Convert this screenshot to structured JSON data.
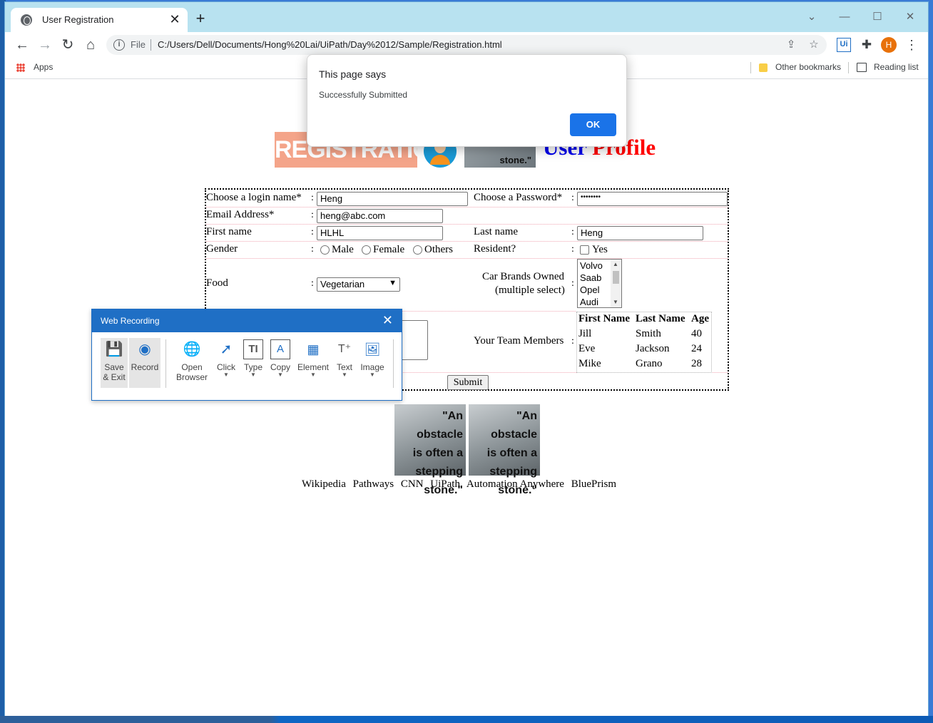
{
  "browser": {
    "tab_title": "User Registration",
    "tab_close": "✕",
    "new_tab": "+",
    "scheme": "File",
    "url": "C:/Users/Dell/Documents/Hong%20Lai/UiPath/Day%2012/Sample/Registration.html",
    "ext_uipath": "Ui",
    "avatar_letter": "H",
    "bookmarks": {
      "apps": "Apps",
      "other": "Other bookmarks",
      "reading": "Reading list"
    }
  },
  "alert": {
    "heading": "This page says",
    "message": "Successfully Submitted",
    "ok_label": "OK"
  },
  "page": {
    "banner_text": "REGISTRATION",
    "stone_caption": "stone.\"",
    "title_word1": "User",
    "title_word2": "Profile",
    "form": {
      "login_label": "Choose a login name*",
      "login_value": "Heng",
      "password_label": "Choose a Password*",
      "password_value": "••••••••",
      "email_label": "Email Address*",
      "email_value": "heng@abc.com",
      "first_label": "First name",
      "first_value": "HLHL",
      "last_label": "Last name",
      "last_value": "Heng",
      "gender_label": "Gender",
      "gender_options": [
        "Male",
        "Female",
        "Others"
      ],
      "resident_label": "Resident?",
      "resident_option": "Yes",
      "food_label": "Food",
      "food_value": "Vegetarian",
      "cars_label_1": "Car Brands Owned",
      "cars_label_2": "(multiple select)",
      "cars": [
        "Volvo",
        "Saab",
        "Opel",
        "Audi"
      ],
      "team_label": "Your Team Members",
      "team_headers": [
        "First Name",
        "Last Name",
        "Age"
      ],
      "team_rows": [
        [
          "Jill",
          "Smith",
          "40"
        ],
        [
          "Eve",
          "Jackson",
          "24"
        ],
        [
          "Mike",
          "Grano",
          "28"
        ]
      ],
      "submit_label": "Submit"
    },
    "quote": [
      "\"An obstacle",
      "is often a",
      "stepping",
      "stone.\""
    ],
    "links": [
      "Wikipedia",
      "Pathways",
      "CNN",
      "UiPath",
      "Automation Anywhere",
      "BluePrism"
    ]
  },
  "recorder": {
    "title": "Web Recording",
    "tools": {
      "save_1": "Save",
      "save_2": "& Exit",
      "record": "Record",
      "open_1": "Open",
      "open_2": "Browser",
      "click": "Click",
      "type": "Type",
      "copy": "Copy",
      "element": "Element",
      "text": "Text",
      "image": "Image"
    }
  }
}
